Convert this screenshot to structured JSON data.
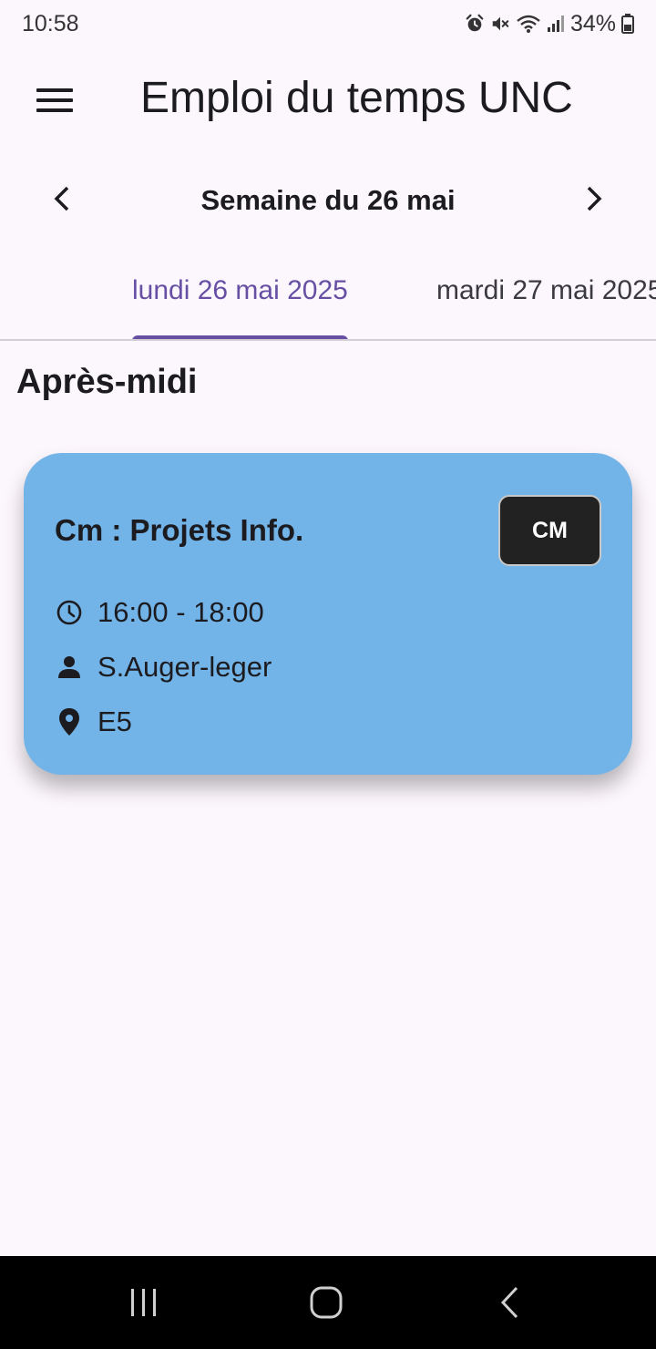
{
  "status_bar": {
    "time": "10:58",
    "battery": "34%",
    "icons": [
      "alarm-icon",
      "mute-icon",
      "wifi-icon",
      "signal-icon",
      "battery-icon"
    ]
  },
  "app_bar": {
    "title": "Emploi du temps UNC",
    "menu_icon": "menu-icon"
  },
  "week_nav": {
    "label": "Semaine du 26 mai",
    "prev_icon": "chevron-left-icon",
    "next_icon": "chevron-right-icon"
  },
  "tabs": [
    {
      "label": "lundi 26 mai 2025",
      "active": true
    },
    {
      "label": "mardi 27 mai 2025",
      "active": false
    }
  ],
  "section": {
    "title": "Après-midi"
  },
  "course": {
    "name": "Cm : Projets Info.",
    "type": "CM",
    "time": "16:00 - 18:00",
    "teacher": "S.Auger-leger",
    "room": "E5",
    "card_color": "#72B3E8"
  },
  "colors": {
    "accent": "#6750A4",
    "background": "#FCF7FD",
    "badge": "#222222"
  },
  "system_nav": {
    "icons": [
      "recents-icon",
      "home-icon",
      "back-icon"
    ]
  }
}
